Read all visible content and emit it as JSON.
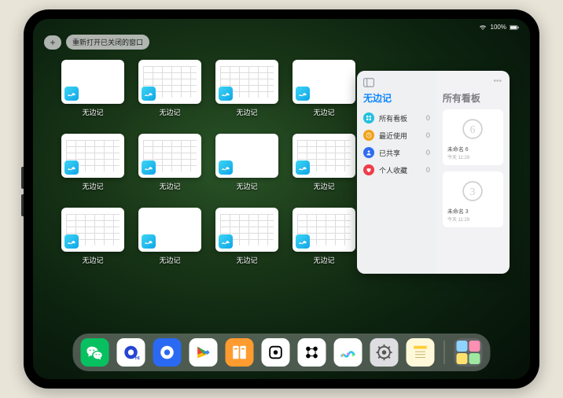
{
  "status": {
    "wifi": "wifi",
    "battery": "100%",
    "signal": "···"
  },
  "topbar": {
    "plus_label": "+",
    "reopen_label": "重新打开已关闭的窗口"
  },
  "windows": [
    {
      "label": "无边记",
      "variant": "plain"
    },
    {
      "label": "无边记",
      "variant": "grid"
    },
    {
      "label": "无边记",
      "variant": "grid"
    },
    {
      "label": "无边记",
      "variant": "plain"
    },
    {
      "label": "无边记",
      "variant": "grid"
    },
    {
      "label": "无边记",
      "variant": "grid"
    },
    {
      "label": "无边记",
      "variant": "plain"
    },
    {
      "label": "无边记",
      "variant": "grid"
    },
    {
      "label": "无边记",
      "variant": "grid"
    },
    {
      "label": "无边记",
      "variant": "plain"
    },
    {
      "label": "无边记",
      "variant": "grid"
    },
    {
      "label": "无边记",
      "variant": "grid"
    }
  ],
  "panel": {
    "left_title": "无边记",
    "right_title": "所有看板",
    "items": [
      {
        "icon": "squares",
        "color": "#22c0de",
        "label": "所有看板",
        "count": 0
      },
      {
        "icon": "clock",
        "color": "#f0a11b",
        "label": "最近使用",
        "count": 0
      },
      {
        "icon": "person",
        "color": "#2f6cf0",
        "label": "已共享",
        "count": 0
      },
      {
        "icon": "heart",
        "color": "#ef3d4a",
        "label": "个人收藏",
        "count": 0
      }
    ],
    "boards": [
      {
        "glyph": "6",
        "name": "未命名 6",
        "time": "今天 11:29"
      },
      {
        "glyph": "3",
        "name": "未命名 3",
        "time": "今天 11:29"
      }
    ]
  },
  "dock": {
    "apps": [
      {
        "name": "wechat",
        "bg": "#07c160"
      },
      {
        "name": "quark-hd",
        "bg": "#ffffff"
      },
      {
        "name": "quark",
        "bg": "#2a6af2"
      },
      {
        "name": "play",
        "bg": "#ffffff"
      },
      {
        "name": "books",
        "bg": "#ff9b2f"
      },
      {
        "name": "dice",
        "bg": "#ffffff"
      },
      {
        "name": "connect",
        "bg": "#ffffff"
      },
      {
        "name": "freeform",
        "bg": "#ffffff"
      },
      {
        "name": "settings",
        "bg": "#dedee2"
      },
      {
        "name": "notes",
        "bg": "#fff9d9"
      }
    ]
  },
  "colors": {
    "panel_title_left": "#0a84ff",
    "panel_title_right": "#7d7d82"
  }
}
